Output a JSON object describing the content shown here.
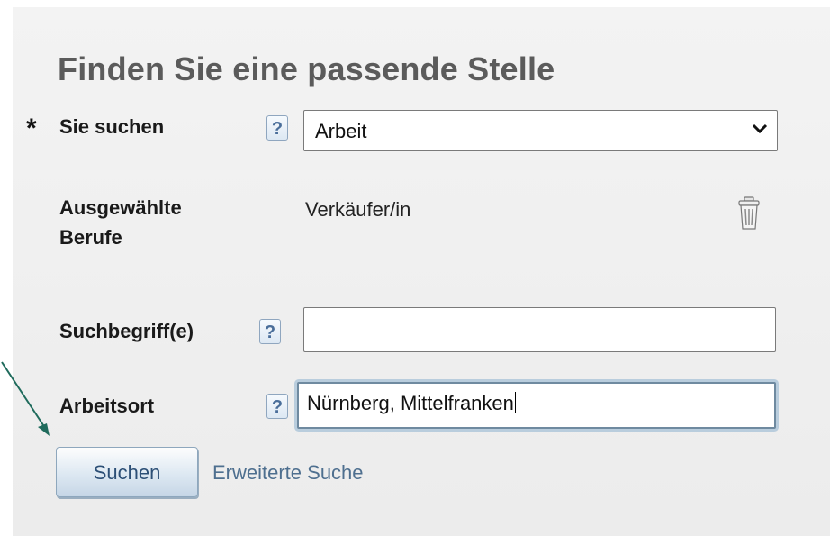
{
  "form": {
    "title": "Finden Sie eine passende Stelle",
    "required_marker": "*",
    "help_glyph": "?",
    "search_type": {
      "label": "Sie suchen",
      "selected": "Arbeit"
    },
    "selected_jobs": {
      "label_line1": "Ausgewählte",
      "label_line2": "Berufe",
      "value": "Verkäufer/in"
    },
    "keywords": {
      "label": "Suchbegriff(e)",
      "value": ""
    },
    "location": {
      "label": "Arbeitsort",
      "value": "Nürnberg, Mittelfranken"
    },
    "search_button": "Suchen",
    "advanced_link": "Erweiterte Suche"
  },
  "icons": {
    "help": "help-icon",
    "dropdown": "chevron-down-icon",
    "delete": "trash-icon",
    "annotation": "arrow-annotation"
  },
  "colors": {
    "title": "#5b5b5b",
    "accent": "#2c4f76",
    "link": "#4e6f8f",
    "annotation_arrow": "#1f6b5c"
  }
}
